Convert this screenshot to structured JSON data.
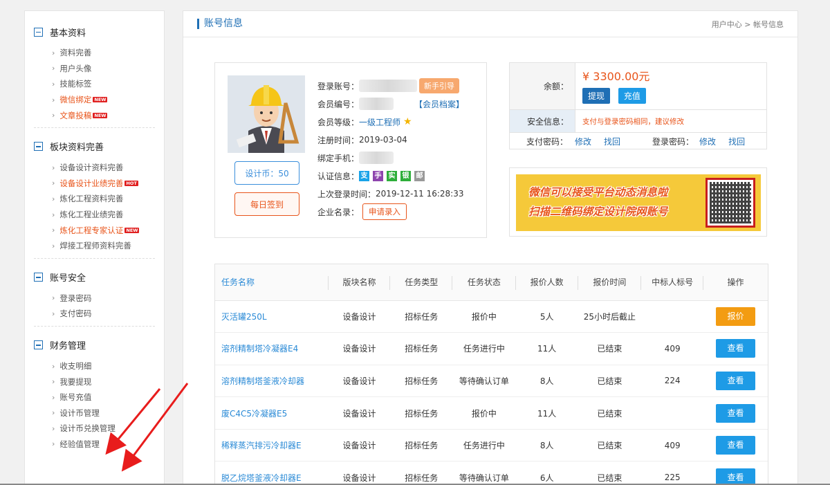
{
  "sidebar": {
    "sections": [
      {
        "title": "基本资料",
        "items": [
          {
            "label": "资料完善"
          },
          {
            "label": "用户头像"
          },
          {
            "label": "技能标签"
          },
          {
            "label": "微信绑定",
            "badge": "NEW",
            "highlight": true
          },
          {
            "label": "文章投稿",
            "badge": "NEW",
            "highlight": true
          }
        ]
      },
      {
        "title": "板块资料完善",
        "items": [
          {
            "label": "设备设计资料完善"
          },
          {
            "label": "设备设计业绩完善",
            "badge": "HOT",
            "highlight": true
          },
          {
            "label": "炼化工程资料完善"
          },
          {
            "label": "炼化工程业绩完善"
          },
          {
            "label": "炼化工程专家认证",
            "badge": "NEW",
            "highlight": true
          },
          {
            "label": "焊接工程师资料完善"
          }
        ]
      },
      {
        "title": "账号安全",
        "items": [
          {
            "label": "登录密码"
          },
          {
            "label": "支付密码"
          }
        ]
      },
      {
        "title": "财务管理",
        "items": [
          {
            "label": "收支明细"
          },
          {
            "label": "我要提现"
          },
          {
            "label": "账号充值"
          },
          {
            "label": "设计币管理"
          },
          {
            "label": "设计币兑换管理"
          },
          {
            "label": "经验值管理"
          }
        ]
      }
    ]
  },
  "header": {
    "title": "账号信息",
    "breadcrumb": "用户中心 > 帐号信息"
  },
  "profile": {
    "coins_label": "设计币：50",
    "checkin_label": "每日签到",
    "login_account_label": "登录账号：",
    "guide_label": "新手引导",
    "member_no_label": "会员编号：",
    "member_file_label": "【会员档案】",
    "level_label": "会员等级：",
    "level_value": "一级工程师",
    "reg_label": "注册时间：",
    "reg_value": "2019-03-04",
    "phone_label": "绑定手机：",
    "cert_label": "认证信息：",
    "certs": [
      {
        "char": "支",
        "color": "#1aa3e8"
      },
      {
        "char": "手",
        "color": "#8e44ad"
      },
      {
        "char": "实",
        "color": "#2eae3a"
      },
      {
        "char": "银",
        "color": "#2eae3a"
      },
      {
        "char": "邮",
        "color": "#999999"
      }
    ],
    "last_login_label": "上次登录时间：",
    "last_login_value": "2019-12-11 16:28:33",
    "company_label": "企业名录：",
    "apply_label": "申请录入"
  },
  "balance": {
    "label": "余额：",
    "amount": "¥ 3300.00元",
    "withdraw": "提现",
    "recharge": "充值",
    "security_label": "安全信息：",
    "security_warn": "支付与登录密码相同，建议修改",
    "pay_pwd_label": "支付密码：",
    "login_pwd_label": "登录密码：",
    "modify": "修改",
    "retrieve": "找回"
  },
  "banner": {
    "line1": "微信可以接受平台动态消息啦",
    "line2": "扫描二维码绑定设计院网账号"
  },
  "tasks": {
    "columns": [
      "任务名称",
      "版块名称",
      "任务类型",
      "任务状态",
      "报价人数",
      "报价时间",
      "中标人标号",
      "操作"
    ],
    "rows": [
      {
        "name": "灭活罐250L",
        "section": "设备设计",
        "type": "招标任务",
        "status": "报价中",
        "count": "5人",
        "time": "25小时后截止",
        "bidder": "",
        "action": "报价",
        "action_color": "#f39c12"
      },
      {
        "name": "溶剂精制塔冷凝器E4",
        "section": "设备设计",
        "type": "招标任务",
        "status": "任务进行中",
        "count": "11人",
        "time": "已结束",
        "bidder": "409",
        "action": "查看",
        "action_color": "#1e9be6"
      },
      {
        "name": "溶剂精制塔釜液冷却器",
        "section": "设备设计",
        "type": "招标任务",
        "status": "等待确认订单",
        "count": "8人",
        "time": "已结束",
        "bidder": "224",
        "action": "查看",
        "action_color": "#1e9be6"
      },
      {
        "name": "废C4C5冷凝器E5",
        "section": "设备设计",
        "type": "招标任务",
        "status": "报价中",
        "count": "11人",
        "time": "已结束",
        "bidder": "",
        "action": "查看",
        "action_color": "#1e9be6"
      },
      {
        "name": "稀释蒸汽排污冷却器E",
        "section": "设备设计",
        "type": "招标任务",
        "status": "任务进行中",
        "count": "8人",
        "time": "已结束",
        "bidder": "409",
        "action": "查看",
        "action_color": "#1e9be6"
      },
      {
        "name": "脱乙烷塔釜液冷却器E",
        "section": "设备设计",
        "type": "招标任务",
        "status": "等待确认订单",
        "count": "6人",
        "time": "已结束",
        "bidder": "225",
        "action": "查看",
        "action_color": "#1e9be6"
      }
    ]
  },
  "colors": {
    "accent": "#1f6fb5",
    "orange": "#e8541a",
    "blue_btn": "#1e9be6",
    "arrow": "#e81c1c"
  }
}
